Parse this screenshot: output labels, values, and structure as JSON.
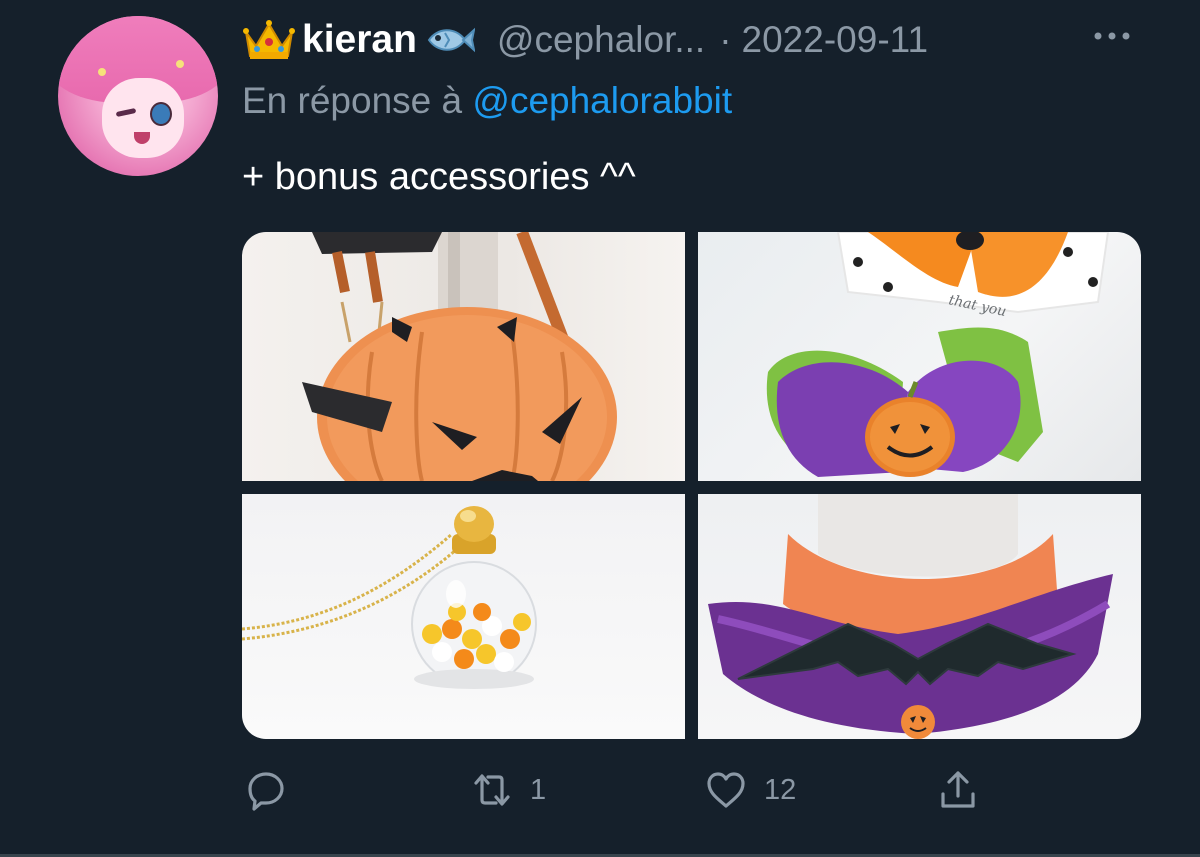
{
  "tweet": {
    "display_name": "kieran",
    "name_prefix_icon": "crown-emoji",
    "name_suffix_icon": "fish-emoji",
    "handle": "@cephalor...",
    "separator": "·",
    "date": "2022-09-11",
    "reply_prefix": "En réponse à",
    "reply_to": "@cephalorabbit",
    "text": "+ bonus accessories ^^",
    "media": [
      {
        "subject": "pumpkin-bag"
      },
      {
        "subject": "halloween-hair-bows"
      },
      {
        "subject": "candy-corn-necklace"
      },
      {
        "subject": "bat-wing-choker"
      }
    ]
  },
  "actions": {
    "reply": {
      "icon": "reply-icon",
      "count": ""
    },
    "retweet": {
      "icon": "retweet-icon",
      "count": "1"
    },
    "like": {
      "icon": "heart-icon",
      "count": "12"
    },
    "share": {
      "icon": "share-icon"
    }
  },
  "colors": {
    "background": "#15202b",
    "text_primary": "#ffffff",
    "text_secondary": "#8b98a5",
    "link": "#1d9bf0"
  }
}
